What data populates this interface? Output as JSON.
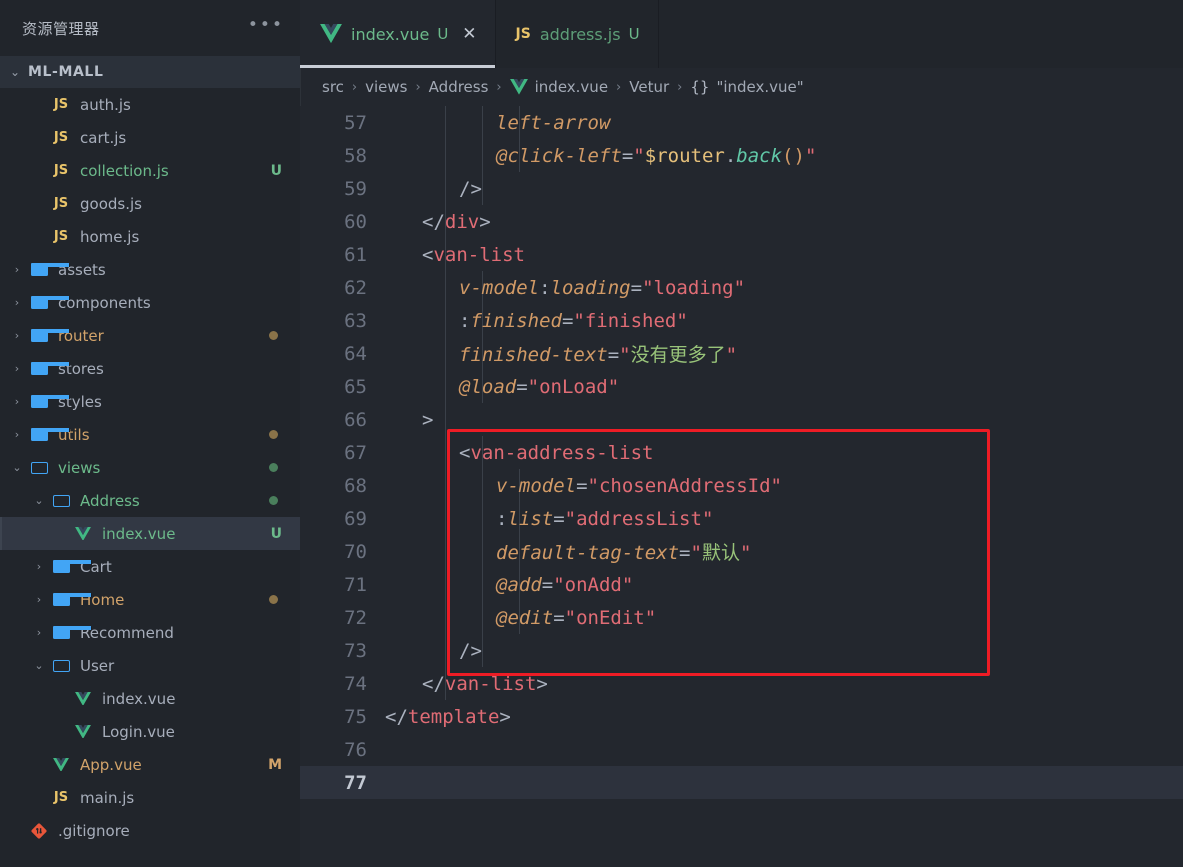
{
  "sidebar": {
    "title": "资源管理器",
    "more_icon": "ellipsis-icon",
    "root": {
      "label": "ML-MALL",
      "expanded": true
    },
    "items": [
      {
        "label": "auth.js",
        "icon": "js-icon",
        "indent": 2,
        "twisty": "",
        "color": "normal",
        "badge": "",
        "dot": ""
      },
      {
        "label": "cart.js",
        "icon": "js-icon",
        "indent": 2,
        "twisty": "",
        "color": "normal",
        "badge": "",
        "dot": ""
      },
      {
        "label": "collection.js",
        "icon": "js-icon",
        "indent": 2,
        "twisty": "",
        "color": "green",
        "badge": "U",
        "dot": ""
      },
      {
        "label": "goods.js",
        "icon": "js-icon",
        "indent": 2,
        "twisty": "",
        "color": "normal",
        "badge": "",
        "dot": ""
      },
      {
        "label": "home.js",
        "icon": "js-icon",
        "indent": 2,
        "twisty": "",
        "color": "normal",
        "badge": "",
        "dot": ""
      },
      {
        "label": "assets",
        "icon": "folder-icon",
        "indent": 1,
        "twisty": "›",
        "color": "normal",
        "badge": "",
        "dot": ""
      },
      {
        "label": "components",
        "icon": "folder-icon",
        "indent": 1,
        "twisty": "›",
        "color": "normal",
        "badge": "",
        "dot": ""
      },
      {
        "label": "router",
        "icon": "folder-icon",
        "indent": 1,
        "twisty": "›",
        "color": "orange",
        "badge": "",
        "dot": "orange"
      },
      {
        "label": "stores",
        "icon": "folder-icon",
        "indent": 1,
        "twisty": "›",
        "color": "normal",
        "badge": "",
        "dot": ""
      },
      {
        "label": "styles",
        "icon": "folder-icon",
        "indent": 1,
        "twisty": "›",
        "color": "normal",
        "badge": "",
        "dot": ""
      },
      {
        "label": "utils",
        "icon": "folder-icon",
        "indent": 1,
        "twisty": "›",
        "color": "orange",
        "badge": "",
        "dot": "orange"
      },
      {
        "label": "views",
        "icon": "folder-open-icon",
        "indent": 1,
        "twisty": "⌄",
        "color": "green",
        "badge": "",
        "dot": "green"
      },
      {
        "label": "Address",
        "icon": "folder-open-icon",
        "indent": 2,
        "twisty": "⌄",
        "color": "green",
        "badge": "",
        "dot": "green"
      },
      {
        "label": "index.vue",
        "icon": "vue-icon",
        "indent": 3,
        "twisty": "",
        "color": "green",
        "badge": "U",
        "dot": "",
        "selected": true
      },
      {
        "label": "Cart",
        "icon": "folder-icon",
        "indent": 2,
        "twisty": "›",
        "color": "normal",
        "badge": "",
        "dot": ""
      },
      {
        "label": "Home",
        "icon": "folder-icon",
        "indent": 2,
        "twisty": "›",
        "color": "orange",
        "badge": "",
        "dot": "orange"
      },
      {
        "label": "Recommend",
        "icon": "folder-icon",
        "indent": 2,
        "twisty": "›",
        "color": "normal",
        "badge": "",
        "dot": ""
      },
      {
        "label": "User",
        "icon": "folder-open-icon",
        "indent": 2,
        "twisty": "⌄",
        "color": "normal",
        "badge": "",
        "dot": ""
      },
      {
        "label": "index.vue",
        "icon": "vue-icon",
        "indent": 3,
        "twisty": "",
        "color": "normal",
        "badge": "",
        "dot": ""
      },
      {
        "label": "Login.vue",
        "icon": "vue-icon",
        "indent": 3,
        "twisty": "",
        "color": "normal",
        "badge": "",
        "dot": ""
      },
      {
        "label": "App.vue",
        "icon": "vue-icon",
        "indent": 2,
        "twisty": "",
        "color": "orange",
        "badge": "M",
        "dot": ""
      },
      {
        "label": "main.js",
        "icon": "js-icon",
        "indent": 2,
        "twisty": "",
        "color": "normal",
        "badge": "",
        "dot": ""
      },
      {
        "label": ".gitignore",
        "icon": "git-icon",
        "indent": 1,
        "twisty": "",
        "color": "normal",
        "badge": "",
        "dot": ""
      }
    ]
  },
  "tabs": [
    {
      "name": "index.vue",
      "icon": "vue-icon",
      "status": "U",
      "close": "✕",
      "active": true
    },
    {
      "name": "address.js",
      "icon": "js-icon",
      "status": "U",
      "close": "",
      "active": false
    }
  ],
  "breadcrumb": {
    "segments": [
      "src",
      "views",
      "Address",
      "index.vue",
      "Vetur",
      "\"index.vue\""
    ],
    "separator": "›",
    "brace": "{}",
    "vue_icon": "vue-icon"
  },
  "editor": {
    "current_line": 77,
    "first_line": 57,
    "lines": [
      {
        "n": 57,
        "indent": 3,
        "tokens": [
          {
            "c": "t-attr",
            "t": "left-arrow"
          }
        ]
      },
      {
        "n": 58,
        "indent": 3,
        "tokens": [
          {
            "c": "t-attr",
            "t": "@click-left"
          },
          {
            "c": "t-eq",
            "t": "="
          },
          {
            "c": "t-quote",
            "t": "\""
          },
          {
            "c": "t-var",
            "t": "$router"
          },
          {
            "c": "t-punc",
            "t": "."
          },
          {
            "c": "t-fn",
            "t": "back"
          },
          {
            "c": "t-paren",
            "t": "()"
          },
          {
            "c": "t-quote",
            "t": "\""
          }
        ]
      },
      {
        "n": 59,
        "indent": 2,
        "tokens": [
          {
            "c": "t-punc",
            "t": "/>"
          }
        ]
      },
      {
        "n": 60,
        "indent": 1,
        "tokens": [
          {
            "c": "t-punc",
            "t": "</"
          },
          {
            "c": "t-tag",
            "t": "div"
          },
          {
            "c": "t-punc",
            "t": ">"
          }
        ]
      },
      {
        "n": 61,
        "indent": 1,
        "tokens": [
          {
            "c": "t-punc",
            "t": "<"
          },
          {
            "c": "t-tag",
            "t": "van-list"
          }
        ]
      },
      {
        "n": 62,
        "indent": 2,
        "tokens": [
          {
            "c": "t-attr",
            "t": "v-model"
          },
          {
            "c": "t-punc",
            "t": ":"
          },
          {
            "c": "t-attr",
            "t": "loading"
          },
          {
            "c": "t-eq",
            "t": "="
          },
          {
            "c": "t-str",
            "t": "\"loading\""
          }
        ]
      },
      {
        "n": 63,
        "indent": 2,
        "tokens": [
          {
            "c": "t-punc",
            "t": ":"
          },
          {
            "c": "t-attr",
            "t": "finished"
          },
          {
            "c": "t-eq",
            "t": "="
          },
          {
            "c": "t-str",
            "t": "\"finished\""
          }
        ]
      },
      {
        "n": 64,
        "indent": 2,
        "tokens": [
          {
            "c": "t-attr",
            "t": "finished-text"
          },
          {
            "c": "t-eq",
            "t": "="
          },
          {
            "c": "t-quote",
            "t": "\""
          },
          {
            "c": "t-cn",
            "t": "没有更多了"
          },
          {
            "c": "t-quote",
            "t": "\""
          }
        ]
      },
      {
        "n": 65,
        "indent": 2,
        "tokens": [
          {
            "c": "t-attr",
            "t": "@load"
          },
          {
            "c": "t-eq",
            "t": "="
          },
          {
            "c": "t-str",
            "t": "\"onLoad\""
          }
        ]
      },
      {
        "n": 66,
        "indent": 1,
        "tokens": [
          {
            "c": "t-punc",
            "t": ">"
          }
        ]
      },
      {
        "n": 67,
        "indent": 2,
        "tokens": [
          {
            "c": "t-punc",
            "t": "<"
          },
          {
            "c": "t-tag",
            "t": "van-address-list"
          }
        ]
      },
      {
        "n": 68,
        "indent": 3,
        "tokens": [
          {
            "c": "t-attr",
            "t": "v-model"
          },
          {
            "c": "t-eq",
            "t": "="
          },
          {
            "c": "t-str",
            "t": "\"chosenAddressId\""
          }
        ]
      },
      {
        "n": 69,
        "indent": 3,
        "tokens": [
          {
            "c": "t-punc",
            "t": ":"
          },
          {
            "c": "t-attr",
            "t": "list"
          },
          {
            "c": "t-eq",
            "t": "="
          },
          {
            "c": "t-str",
            "t": "\"addressList\""
          }
        ]
      },
      {
        "n": 70,
        "indent": 3,
        "tokens": [
          {
            "c": "t-attr",
            "t": "default-tag-text"
          },
          {
            "c": "t-eq",
            "t": "="
          },
          {
            "c": "t-quote",
            "t": "\""
          },
          {
            "c": "t-cn",
            "t": "默认"
          },
          {
            "c": "t-quote",
            "t": "\""
          }
        ]
      },
      {
        "n": 71,
        "indent": 3,
        "tokens": [
          {
            "c": "t-attr",
            "t": "@add"
          },
          {
            "c": "t-eq",
            "t": "="
          },
          {
            "c": "t-str",
            "t": "\"onAdd\""
          }
        ]
      },
      {
        "n": 72,
        "indent": 3,
        "tokens": [
          {
            "c": "t-attr",
            "t": "@edit"
          },
          {
            "c": "t-eq",
            "t": "="
          },
          {
            "c": "t-str",
            "t": "\"onEdit\""
          }
        ]
      },
      {
        "n": 73,
        "indent": 2,
        "tokens": [
          {
            "c": "t-punc",
            "t": "/>"
          }
        ]
      },
      {
        "n": 74,
        "indent": 1,
        "tokens": [
          {
            "c": "t-punc",
            "t": "</"
          },
          {
            "c": "t-tag",
            "t": "van-list"
          },
          {
            "c": "t-punc",
            "t": ">"
          }
        ]
      },
      {
        "n": 75,
        "indent": 0,
        "tokens": [
          {
            "c": "t-punc",
            "t": "</"
          },
          {
            "c": "t-tag",
            "t": "template"
          },
          {
            "c": "t-punc",
            "t": ">"
          }
        ]
      },
      {
        "n": 76,
        "indent": 0,
        "tokens": []
      },
      {
        "n": 77,
        "indent": 0,
        "tokens": []
      }
    ],
    "highlight_box": {
      "from_line": 67,
      "to_line": 73,
      "color": "#ee1c25"
    }
  },
  "colors": {
    "sidebar_bg": "#21252b",
    "editor_bg": "#23272e",
    "accent_red": "#ee1c25",
    "git_green": "#6cba8b",
    "git_orange": "#d2a36a",
    "folder_blue": "#42a5f5"
  }
}
